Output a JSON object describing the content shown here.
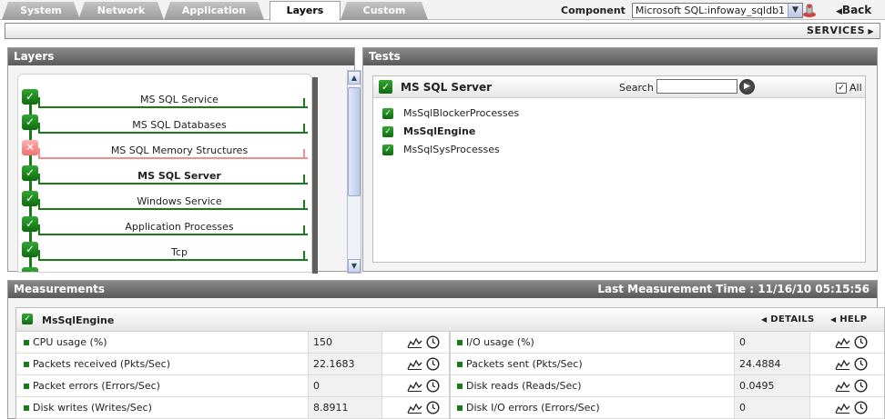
{
  "tabs": [
    {
      "label": "System",
      "active": false
    },
    {
      "label": "Network",
      "active": false
    },
    {
      "label": "Application",
      "active": false
    },
    {
      "label": "Layers",
      "active": true
    },
    {
      "label": "Custom",
      "active": false
    }
  ],
  "component": {
    "label": "Component",
    "value": "Microsoft SQL:infoway_sqldb1"
  },
  "back_label": "Back",
  "services_label": "SERVICES",
  "layers_panel": {
    "title": "Layers",
    "items": [
      {
        "label": "MS SQL Service",
        "status": "ok",
        "bold": false
      },
      {
        "label": "MS SQL Databases",
        "status": "ok",
        "bold": false
      },
      {
        "label": "MS SQL Memory Structures",
        "status": "error",
        "bold": false
      },
      {
        "label": "MS SQL Server",
        "status": "ok",
        "bold": true
      },
      {
        "label": "Windows Service",
        "status": "ok",
        "bold": false
      },
      {
        "label": "Application Processes",
        "status": "ok",
        "bold": false
      },
      {
        "label": "Tcp",
        "status": "ok",
        "bold": false
      }
    ]
  },
  "tests_panel": {
    "title": "Tests",
    "layer_name": "MS SQL Server",
    "search_label": "Search",
    "search_value": "",
    "all_label": "All",
    "items": [
      {
        "label": "MsSqlBlockerProcesses",
        "bold": false
      },
      {
        "label": "MsSqlEngine",
        "bold": true
      },
      {
        "label": "MsSqlSysProcesses",
        "bold": false
      }
    ]
  },
  "measurements": {
    "title": "Measurements",
    "last_time_label": "Last Measurement Time : 11/16/10 05:15:56",
    "test_name": "MsSqlEngine",
    "details_label": "DETAILS",
    "help_label": "HELP",
    "rows": [
      {
        "left_name": "CPU usage (%)",
        "left_value": "150",
        "right_name": "I/O usage (%)",
        "right_value": "0"
      },
      {
        "left_name": "Packets received (Pkts/Sec)",
        "left_value": "22.1683",
        "right_name": "Packets sent (Pkts/Sec)",
        "right_value": "24.4884"
      },
      {
        "left_name": "Packet errors (Errors/Sec)",
        "left_value": "0",
        "right_name": "Disk reads (Reads/Sec)",
        "right_value": "0.0495"
      },
      {
        "left_name": "Disk writes (Writes/Sec)",
        "left_value": "8.8911",
        "right_name": "Disk I/O errors (Errors/Sec)",
        "right_value": "0"
      }
    ]
  }
}
